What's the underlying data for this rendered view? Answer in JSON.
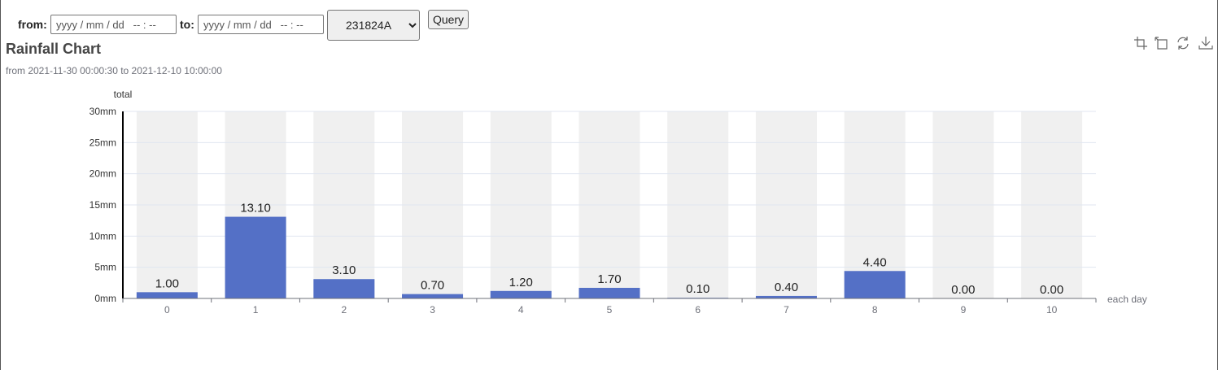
{
  "query": {
    "from_label": "from:",
    "from_placeholder": "yyyy / mm / dd   -- : --",
    "to_label": "to:",
    "to_placeholder": "yyyy / mm / dd   -- : --",
    "station_selected": "231824A",
    "query_button": "Query"
  },
  "toolbox": {
    "icons": [
      "zoom-icon",
      "zoom-reset-icon",
      "restore-icon",
      "download-icon"
    ]
  },
  "colors": {
    "bar": "#5470c6",
    "bar_background": "#f0f0f0",
    "grid": "#e0e6f1",
    "axis": "#6e7079"
  },
  "chart_data": {
    "type": "bar",
    "title": "Rainfall Chart",
    "subtitle": "from 2021-11-30 00:00:30 to 2021-12-10 10:00:00",
    "ylabel": "total",
    "xlabel": "each day",
    "y_unit": "mm",
    "ylim": [
      0,
      30
    ],
    "yticks": [
      0,
      5,
      10,
      15,
      20,
      25,
      30
    ],
    "categories": [
      "0",
      "1",
      "2",
      "3",
      "4",
      "5",
      "6",
      "7",
      "8",
      "9",
      "10"
    ],
    "values": [
      1.0,
      13.1,
      3.1,
      0.7,
      1.2,
      1.7,
      0.1,
      0.4,
      4.4,
      0.0,
      0.0
    ],
    "value_labels": [
      "1.00",
      "13.10",
      "3.10",
      "0.70",
      "1.20",
      "1.70",
      "0.10",
      "0.40",
      "4.40",
      "0.00",
      "0.00"
    ],
    "grid": true,
    "show_bar_background": true
  }
}
